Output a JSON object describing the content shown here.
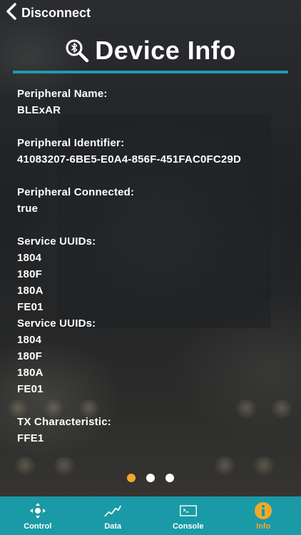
{
  "header": {
    "back_label": "Disconnect",
    "title": "Device Info"
  },
  "info": {
    "peripheral_name_label": "Peripheral Name:",
    "peripheral_name_value": "BLExAR",
    "peripheral_identifier_label": "Peripheral Identifier:",
    "peripheral_identifier_value": "41083207-6BE5-E0A4-856F-451FAC0FC29D",
    "peripheral_connected_label": "Peripheral Connected:",
    "peripheral_connected_value": "true",
    "service_groups": [
      {
        "label": "Service UUIDs:",
        "uuids": [
          "1804",
          "180F",
          "180A",
          "FE01"
        ]
      },
      {
        "label": "Service UUIDs:",
        "uuids": [
          "1804",
          "180F",
          "180A",
          "FE01"
        ]
      }
    ],
    "tx_characteristic_label": "TX Characteristic:",
    "tx_characteristic_value": "FFE1"
  },
  "page_dots": {
    "count": 3,
    "active_index": 0
  },
  "tabbar": {
    "tabs": [
      {
        "label": "Control",
        "icon": "dpad-icon"
      },
      {
        "label": "Data",
        "icon": "line-chart-icon"
      },
      {
        "label": "Console",
        "icon": "terminal-icon"
      },
      {
        "label": "Info",
        "icon": "info-icon"
      }
    ],
    "active_index": 3
  },
  "colors": {
    "accent_teal": "#1a9aa6",
    "active_orange": "#f0a92b",
    "text": "#ffffff"
  }
}
